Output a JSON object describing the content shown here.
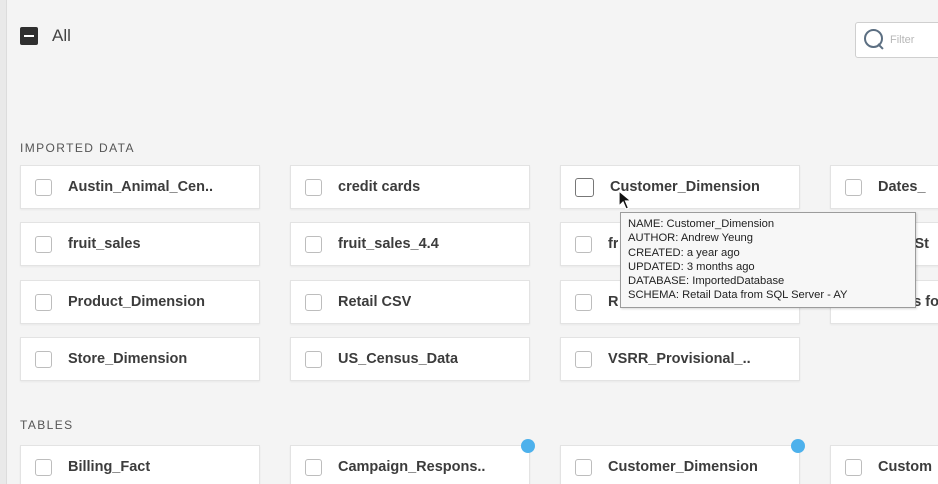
{
  "header": {
    "all_label": "All",
    "filter_placeholder": "Filter"
  },
  "imported": {
    "title": "IMPORTED DATA",
    "cards": [
      {
        "label": "Austin_Animal_Cen.."
      },
      {
        "label": "credit cards"
      },
      {
        "label": "Customer_Dimension"
      },
      {
        "label": "Dates_"
      },
      {
        "label": "fruit_sales"
      },
      {
        "label": "fruit_sales_4.4"
      },
      {
        "label": "fr"
      },
      {
        "label": "St"
      },
      {
        "label": "Product_Dimension"
      },
      {
        "label": "Retail CSV"
      },
      {
        "label": "R"
      },
      {
        "label": "s fo"
      },
      {
        "label": "Store_Dimension"
      },
      {
        "label": "US_Census_Data"
      },
      {
        "label": "VSRR_Provisional_.."
      }
    ]
  },
  "tables": {
    "title": "TABLES",
    "cards": [
      {
        "label": "Billing_Fact"
      },
      {
        "label": "Campaign_Respons.."
      },
      {
        "label": "Customer_Dimension"
      },
      {
        "label": "Custom"
      }
    ]
  },
  "tooltip": {
    "name": "NAME: Customer_Dimension",
    "author": "AUTHOR: Andrew Yeung",
    "created": "CREATED: a year ago",
    "updated": "UPDATED: 3 months ago",
    "database": "DATABASE: ImportedDatabase",
    "schema": "SCHEMA: Retail Data from SQL Server - AY"
  },
  "colors": {
    "background": "#f4f4f4",
    "badge": "#4db1ec",
    "card": "#ffffff"
  },
  "icons": [
    "select-all-icon",
    "search-icon",
    "checkbox-icon",
    "badge-dot-icon",
    "mouse-cursor-icon"
  ]
}
